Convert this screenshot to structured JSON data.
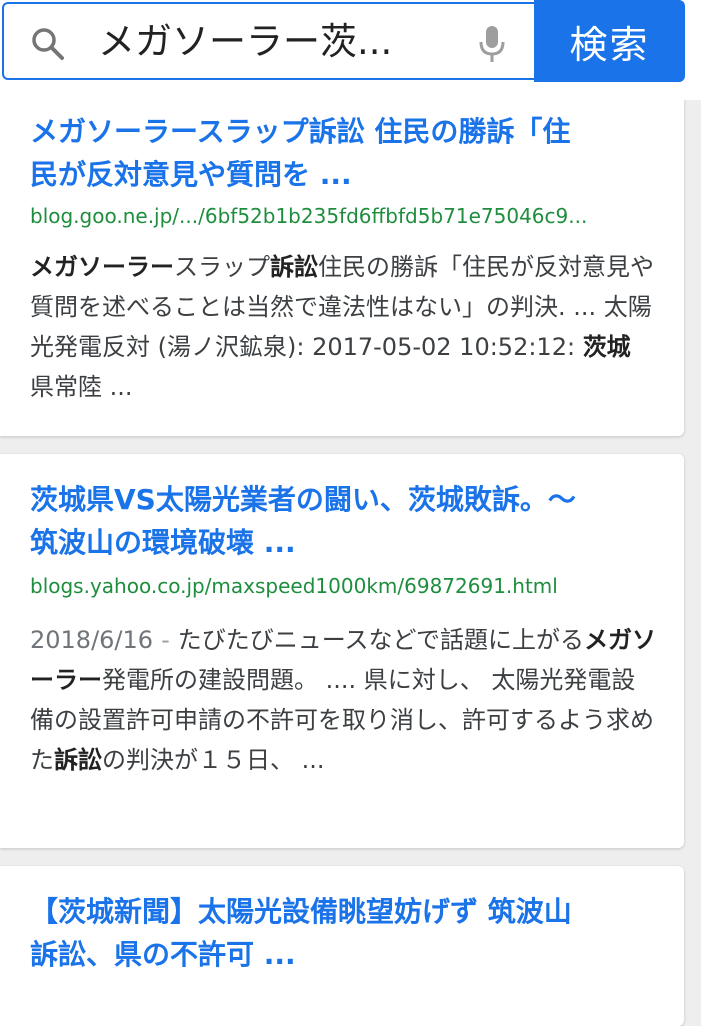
{
  "search": {
    "query": "メガソーラー茨...",
    "button_label": "検索"
  },
  "results": [
    {
      "title_line1": "メガソーラースラップ訴訟 住民の勝訴「住",
      "title_line2": "民が反対意見や質問を ...",
      "url": "blog.goo.ne.jp/.../6bf52b1b235fd6ffbfd5b71e75046c9...",
      "snippet": [
        {
          "text": "メガソーラー",
          "bold": true
        },
        {
          "text": "スラップ",
          "bold": false
        },
        {
          "text": "訴訟",
          "bold": true
        },
        {
          "text": "住民の勝訴「住民が反対意見や質問を述べることは当然で違法性はない」の判決. ... 太陽光発電反対 (湯ノ沢鉱泉): 2017-05-02 10:52:12: ",
          "bold": false
        },
        {
          "text": "茨城",
          "bold": true
        },
        {
          "text": " 県常陸 ...",
          "bold": false
        }
      ]
    },
    {
      "title_line1": "茨城県VS太陽光業者の闘い、茨城敗訴。〜",
      "title_line2": "筑波山の環境破壊 ...",
      "url": "blogs.yahoo.co.jp/maxspeed1000km/69872691.html",
      "date": "2018/6/16",
      "date_separator": "-",
      "snippet": [
        {
          "text": "たびたびニュースなどで話題に上がる",
          "bold": false
        },
        {
          "text": "メガソーラー",
          "bold": true
        },
        {
          "text": "発電所の建設問題。 .... 県に対し、 太陽光発電設備の設置許可申請の不許可を取り消し、許可するよう求めた",
          "bold": false
        },
        {
          "text": "訴訟",
          "bold": true
        },
        {
          "text": "の判決が１５日、 ...",
          "bold": false
        }
      ]
    },
    {
      "title_line1": "【茨城新聞】太陽光設備眺望妨げず 筑波山",
      "title_line2": "訴訟、県の不許可 ..."
    }
  ],
  "colors": {
    "accent": "#1a73e8",
    "link": "#1a73e8",
    "url": "#1e8e3e",
    "snippet": "#3c4043",
    "background": "#eeeeee"
  },
  "icons": {
    "search": "search-icon",
    "mic": "mic-icon"
  }
}
